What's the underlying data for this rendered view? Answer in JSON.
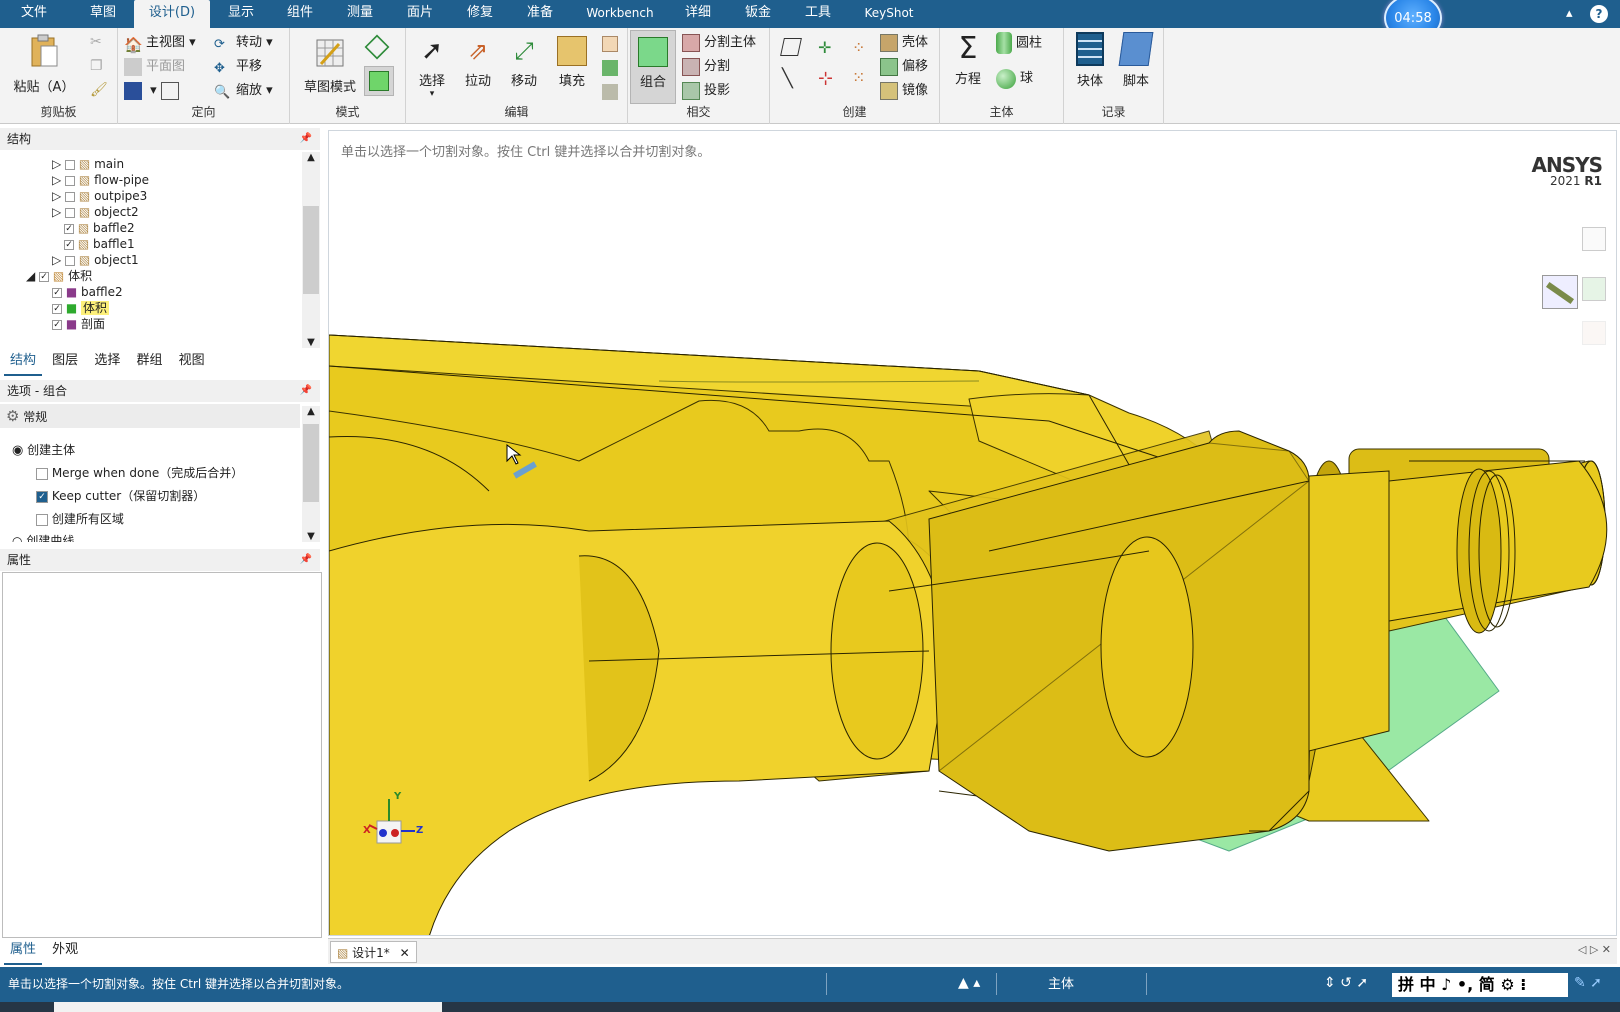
{
  "menubar": {
    "items": [
      "文件",
      "草图",
      "设计(D)",
      "显示",
      "组件",
      "测量",
      "面片",
      "修复",
      "准备",
      "Workbench",
      "详细",
      "钣金",
      "工具",
      "KeyShot"
    ],
    "active_index": 2,
    "timer": "04:58",
    "collapse": "▴",
    "help": "?"
  },
  "ribbon": {
    "clipboard": {
      "label": "剪贴板",
      "paste": "粘贴（A）"
    },
    "orient": {
      "label": "定向",
      "home": "主视图",
      "plane": "平面图",
      "spin": "转动",
      "pan": "平移",
      "zoom": "缩放"
    },
    "mode": {
      "label": "模式",
      "sketch": "草图模式"
    },
    "edit": {
      "label": "编辑",
      "select": "选择",
      "pull": "拉动",
      "move": "移动",
      "fill": "填充"
    },
    "intersect": {
      "label": "相交",
      "combine": "组合",
      "split_body": "分割主体",
      "split": "分割",
      "project": "投影"
    },
    "create": {
      "label": "创建",
      "shell": "壳体",
      "offset": "偏移",
      "mirror": "镜像"
    },
    "body": {
      "label": "主体",
      "equation": "方程",
      "cylinder": "圆柱",
      "sphere": "球"
    },
    "record": {
      "label": "记录",
      "block": "块体",
      "script": "脚本"
    }
  },
  "structure": {
    "title": "结构",
    "items": [
      {
        "label": "main",
        "checked": false,
        "level": 2,
        "expand": true
      },
      {
        "label": "flow-pipe",
        "checked": false,
        "level": 2,
        "expand": true
      },
      {
        "label": "outpipe3",
        "checked": false,
        "level": 2,
        "expand": true
      },
      {
        "label": "object2",
        "checked": false,
        "level": 2,
        "expand": true
      },
      {
        "label": "baffle2",
        "checked": true,
        "level": 2,
        "expand": false
      },
      {
        "label": "baffle1",
        "checked": true,
        "level": 2,
        "expand": false
      },
      {
        "label": "object1",
        "checked": false,
        "level": 2,
        "expand": true
      },
      {
        "label": "体积",
        "checked": true,
        "level": 1,
        "expand": true
      },
      {
        "label": "baffle2",
        "checked": true,
        "level": 2,
        "expand": false
      },
      {
        "label": "体积",
        "checked": true,
        "level": 2,
        "expand": false,
        "highlight": true
      },
      {
        "label": "剖面",
        "checked": true,
        "level": 2,
        "expand": false
      }
    ],
    "tabs": [
      "结构",
      "图层",
      "选择",
      "群组",
      "视图"
    ]
  },
  "options": {
    "title": "选项 - 组合",
    "section": "常规",
    "create_body": "创建主体",
    "merge_when_done": "Merge when done（完成后合并）",
    "keep_cutter": "Keep cutter（保留切割器）",
    "create_all_regions": "创建所有区域",
    "create_curve": "创建曲线"
  },
  "properties": {
    "title": "属性",
    "tabs": [
      "属性",
      "外观"
    ]
  },
  "viewport": {
    "hint": "单击以选择一个切割对象。按住 Ctrl 键并选择以合并切割对象。",
    "brand": "ANSYS",
    "version": "2021",
    "release": "R1",
    "model_color": "#e8ca1e",
    "doc_tab": "设计1*",
    "axes": {
      "x": "X",
      "y": "Y",
      "z": "Z"
    }
  },
  "status": {
    "message": "单击以选择一个切割对象。按住 Ctrl 键并选择以合并切割对象。",
    "mode": "主体",
    "ime": "拼 中 ♪ •, 简 ⚙ ⁝"
  }
}
